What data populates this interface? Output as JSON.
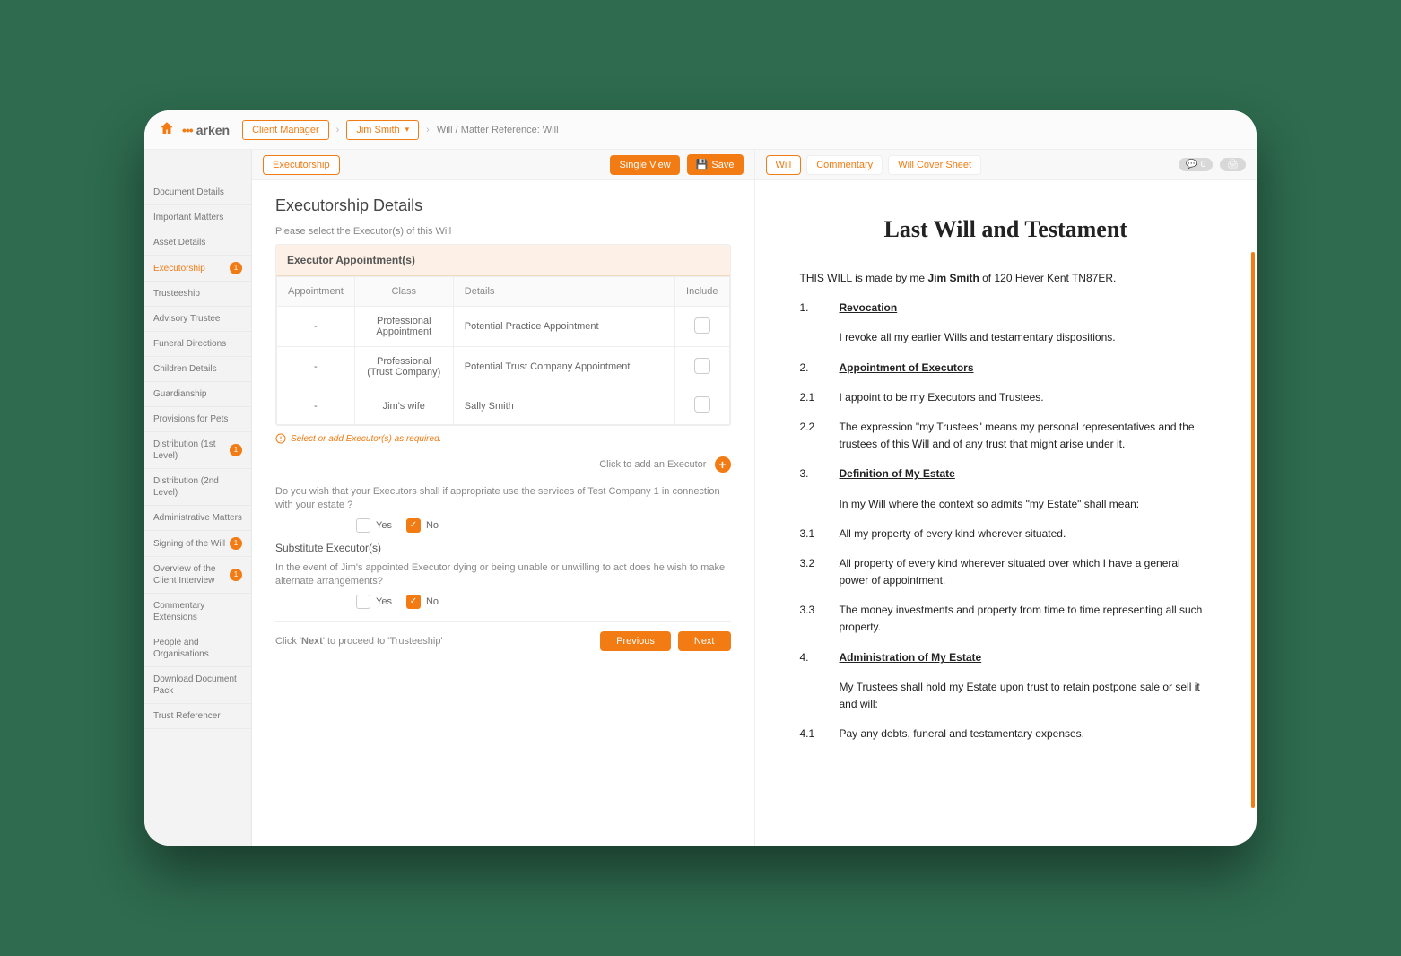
{
  "header": {
    "brand": "arken",
    "client_manager": "Client Manager",
    "client_name": "Jim Smith",
    "matter_ref": "Will / Matter Reference: Will"
  },
  "sidebar": {
    "items": [
      {
        "label": "Document Details",
        "badge": null,
        "active": false
      },
      {
        "label": "Important Matters",
        "badge": null,
        "active": false
      },
      {
        "label": "Asset Details",
        "badge": null,
        "active": false
      },
      {
        "label": "Executorship",
        "badge": "1",
        "active": true
      },
      {
        "label": "Trusteeship",
        "badge": null,
        "active": false
      },
      {
        "label": "Advisory Trustee",
        "badge": null,
        "active": false
      },
      {
        "label": "Funeral Directions",
        "badge": null,
        "active": false
      },
      {
        "label": "Children Details",
        "badge": null,
        "active": false
      },
      {
        "label": "Guardianship",
        "badge": null,
        "active": false
      },
      {
        "label": "Provisions for Pets",
        "badge": null,
        "active": false
      },
      {
        "label": "Distribution (1st Level)",
        "badge": "1",
        "active": false
      },
      {
        "label": "Distribution (2nd Level)",
        "badge": null,
        "active": false
      },
      {
        "label": "Administrative Matters",
        "badge": null,
        "active": false
      },
      {
        "label": "Signing of the Will",
        "badge": "1",
        "active": false
      },
      {
        "label": "Overview of the Client Interview",
        "badge": "1",
        "active": false
      },
      {
        "label": "Commentary Extensions",
        "badge": null,
        "active": false
      },
      {
        "label": "People and Organisations",
        "badge": null,
        "active": false
      },
      {
        "label": "Download Document Pack",
        "badge": null,
        "active": false
      },
      {
        "label": "Trust Referencer",
        "badge": null,
        "active": false
      }
    ]
  },
  "left_tabs": {
    "primary": "Executorship",
    "single_view": "Single View",
    "save": "Save"
  },
  "right_tabs": {
    "tabs": [
      "Will",
      "Commentary",
      "Will Cover Sheet"
    ],
    "counter": "0"
  },
  "form": {
    "title": "Executorship Details",
    "subtitle": "Please select the Executor(s) of this Will",
    "block_title": "Executor Appointment(s)",
    "columns": {
      "appt": "Appointment",
      "class": "Class",
      "details": "Details",
      "include": "Include"
    },
    "rows": [
      {
        "appt": "-",
        "class": "Professional Appointment",
        "details": "Potential Practice Appointment"
      },
      {
        "appt": "-",
        "class": "Professional (Trust Company)",
        "details": "Potential Trust Company Appointment"
      },
      {
        "appt": "-",
        "class": "Jim's wife",
        "details": "Sally Smith"
      }
    ],
    "warning": "Select or add Executor(s) as required.",
    "add_text": "Click to add an Executor",
    "q1": "Do you wish that your Executors shall if appropriate use the services of Test Company 1 in connection with your estate ?",
    "sub_title": "Substitute Executor(s)",
    "q2": "In the event of Jim's appointed Executor dying or being unable or unwilling to act does he wish to make alternate arrangements?",
    "yes": "Yes",
    "no": "No",
    "footer_hint": "Click 'Next' to proceed to 'Trusteeship'",
    "prev": "Previous",
    "next": "Next"
  },
  "document": {
    "title": "Last Will and Testament",
    "intro_pre": "THIS WILL is made by me ",
    "intro_name": "Jim Smith",
    "intro_post": " of 120 Hever Kent TN87ER.",
    "s1": {
      "num": "1.",
      "h": "Revocation",
      "t": "I revoke all my earlier Wills and testamentary dispositions."
    },
    "s2": {
      "num": "2.",
      "h": "Appointment of Executors",
      "r1": {
        "n": "2.1",
        "t": "I appoint to be my Executors and Trustees."
      },
      "r2": {
        "n": "2.2",
        "t": "The expression \"my Trustees\" means my personal representatives and the trustees of this Will and of any trust that might arise under it."
      }
    },
    "s3": {
      "num": "3.",
      "h": "Definition of My Estate",
      "lead": "In my Will where the context so admits \"my Estate\" shall mean:",
      "r1": {
        "n": "3.1",
        "t": "All my property of every kind wherever situated."
      },
      "r2": {
        "n": "3.2",
        "t": "All property of every kind wherever situated over which I have a general power of appointment."
      },
      "r3": {
        "n": "3.3",
        "t": "The money investments and property from time to time representing all such property."
      }
    },
    "s4": {
      "num": "4.",
      "h": "Administration of My Estate",
      "lead": "My Trustees shall hold my Estate upon trust to retain postpone sale or sell it and will:",
      "r1": {
        "n": "4.1",
        "t": "Pay any debts, funeral and testamentary expenses."
      }
    }
  }
}
